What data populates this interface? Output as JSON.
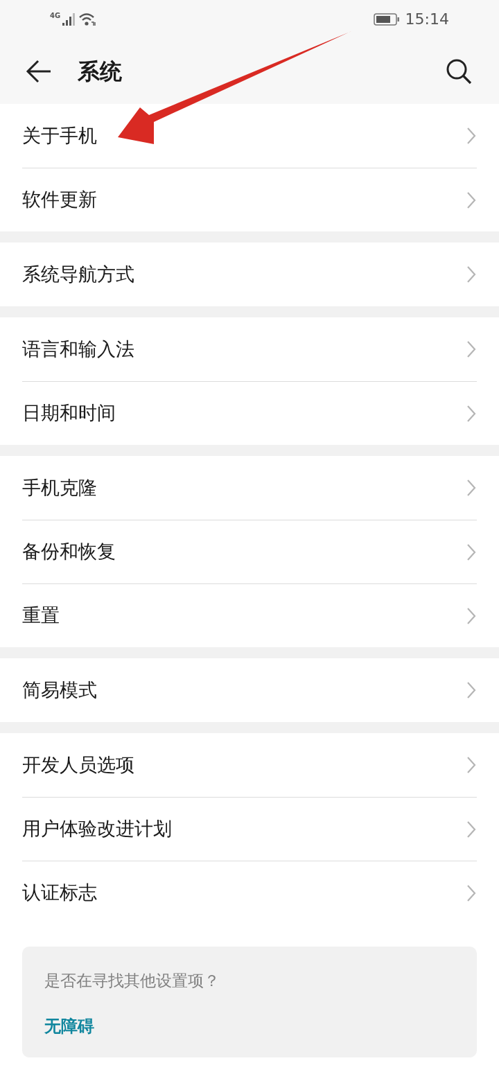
{
  "status_bar": {
    "network": "4G",
    "time": "15:14"
  },
  "header": {
    "title": "系统"
  },
  "groups": [
    {
      "items": [
        {
          "label": "关于手机"
        },
        {
          "label": "软件更新"
        }
      ]
    },
    {
      "items": [
        {
          "label": "系统导航方式"
        }
      ]
    },
    {
      "items": [
        {
          "label": "语言和输入法"
        },
        {
          "label": "日期和时间"
        }
      ]
    },
    {
      "items": [
        {
          "label": "手机克隆"
        },
        {
          "label": "备份和恢复"
        },
        {
          "label": "重置"
        }
      ]
    },
    {
      "items": [
        {
          "label": "简易模式"
        }
      ]
    },
    {
      "items": [
        {
          "label": "开发人员选项"
        },
        {
          "label": "用户体验改进计划"
        },
        {
          "label": "认证标志"
        }
      ]
    }
  ],
  "suggestion_card": {
    "question": "是否在寻找其他设置项？",
    "link": "无障碍"
  }
}
